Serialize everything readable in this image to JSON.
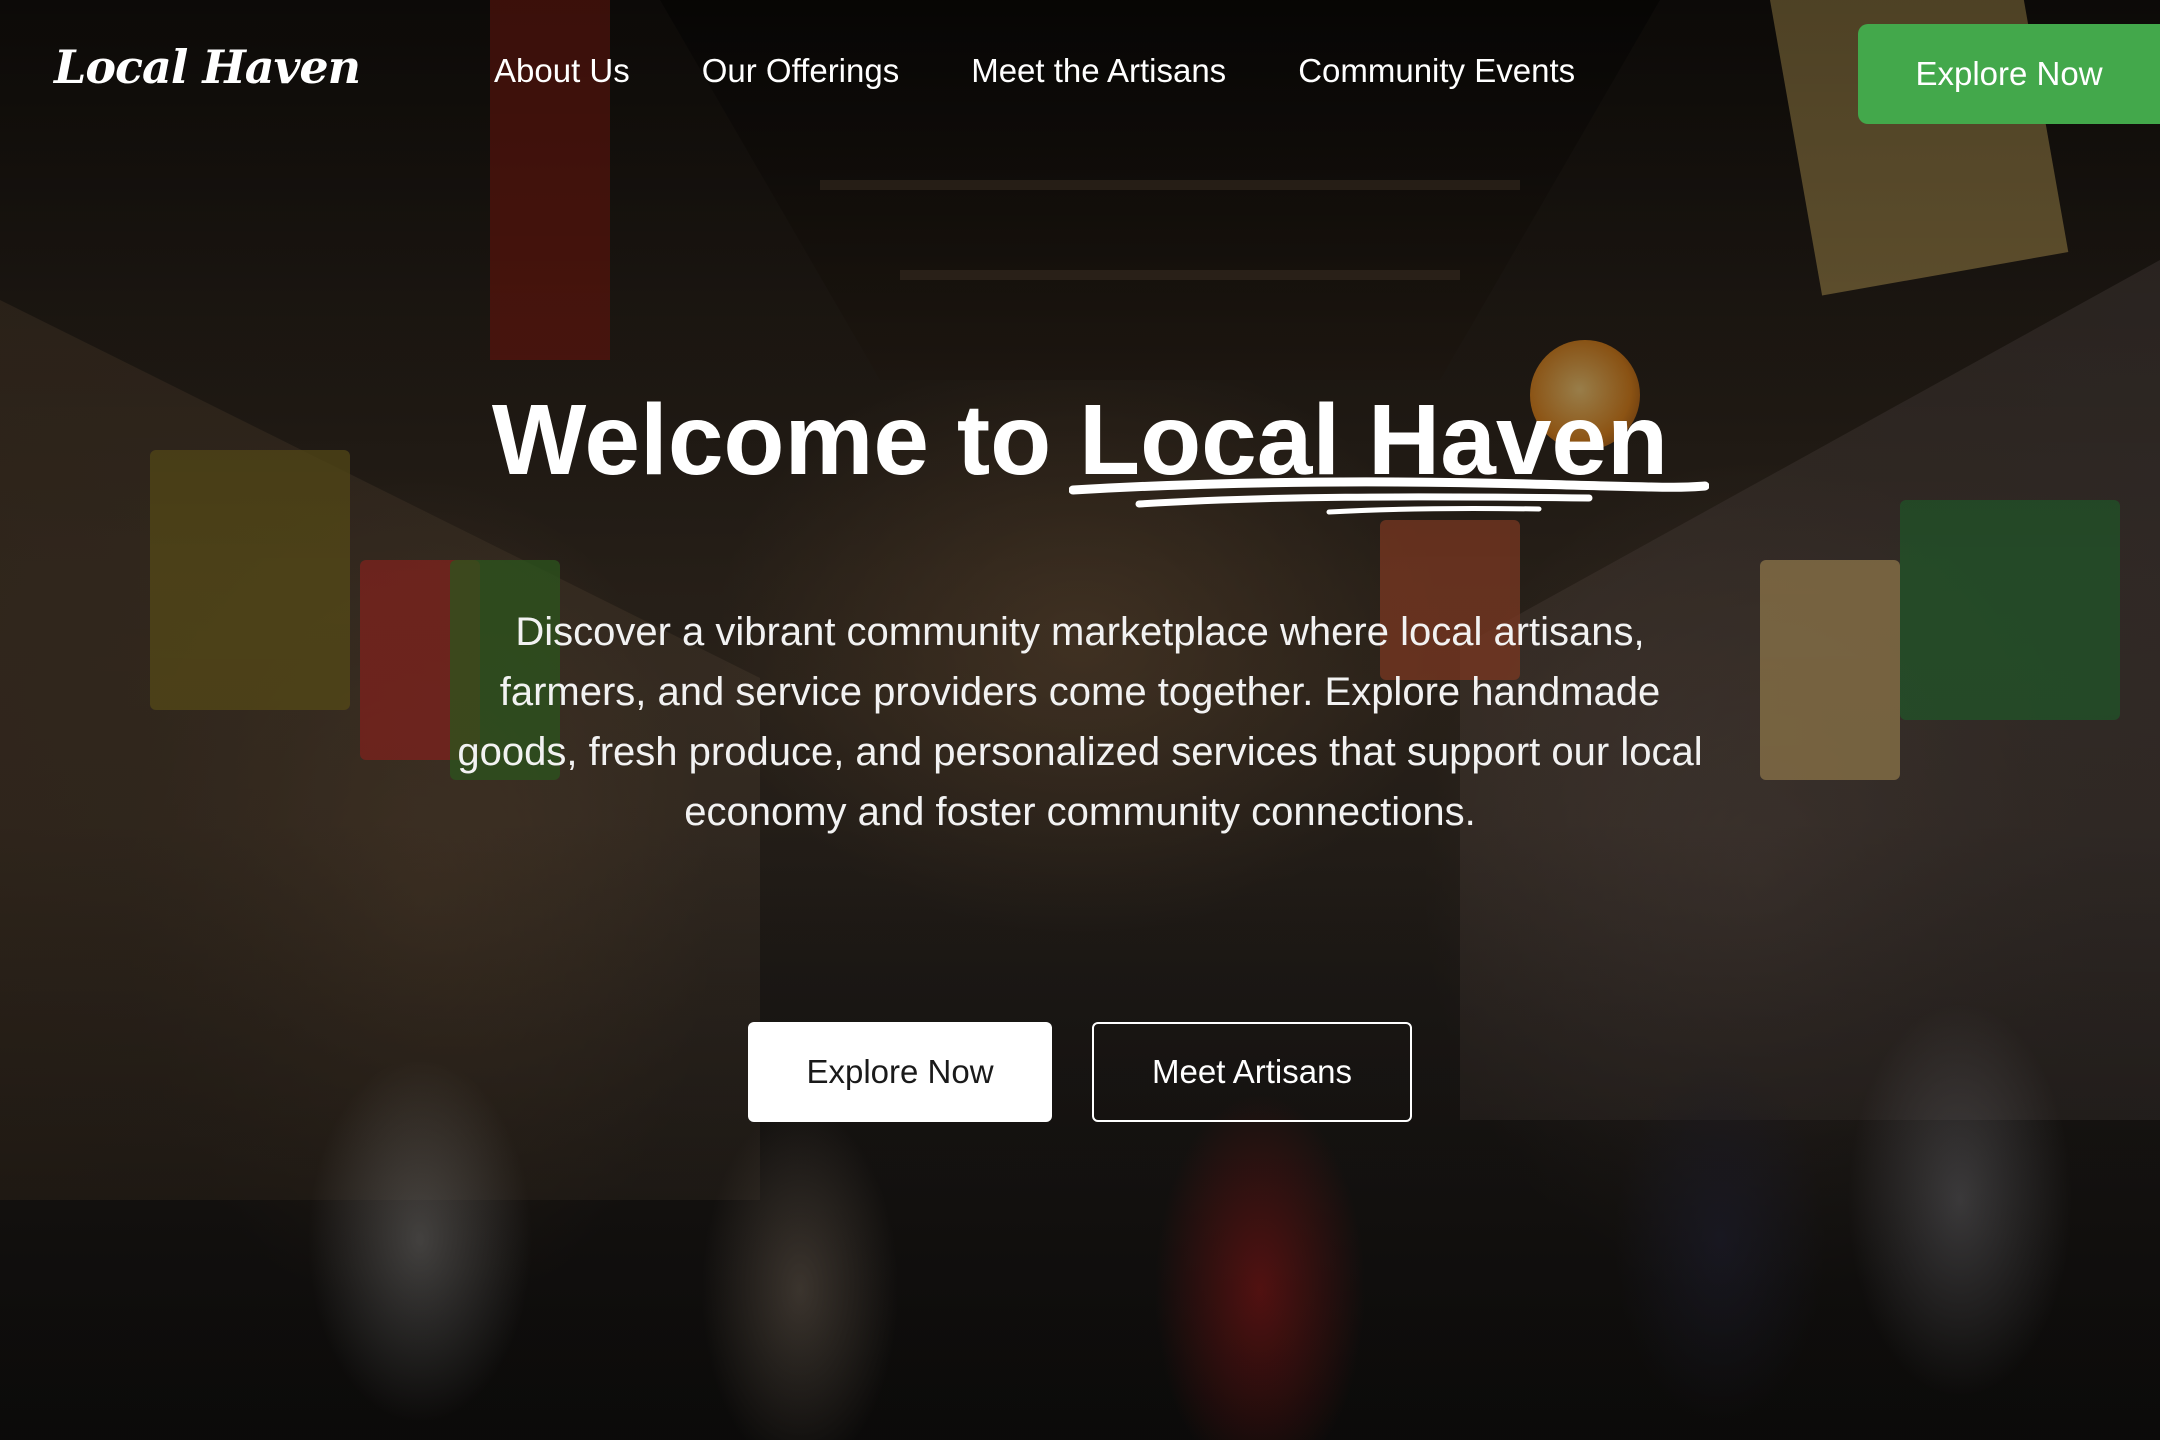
{
  "brand": {
    "logo_text": "Local Haven",
    "accent_color": "#43a84b"
  },
  "nav": {
    "links": [
      {
        "label": "About Us"
      },
      {
        "label": "Our Offerings"
      },
      {
        "label": "Meet the Artisans"
      },
      {
        "label": "Community Events"
      }
    ],
    "cta_label": "Explore Now"
  },
  "hero": {
    "title_prefix": "Welcome to ",
    "title_highlight": "Local Haven",
    "description": "Discover a vibrant community marketplace where local artisans, farmers, and service providers come together. Explore handmade goods, fresh produce, and personalized services that support our local economy and foster community connections.",
    "primary_button": "Explore Now",
    "secondary_button": "Meet Artisans",
    "background_image": "market-crowd-photo"
  }
}
